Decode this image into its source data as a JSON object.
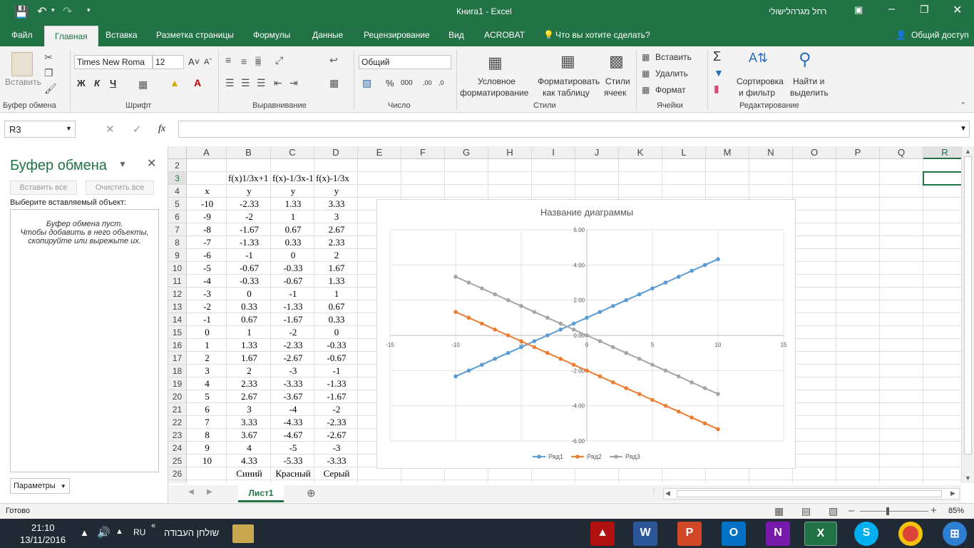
{
  "titlebar": {
    "title": "Книга1  -  Excel",
    "user": "רחל מגרהלישולי"
  },
  "tabs": [
    "Файл",
    "Главная",
    "Вставка",
    "Разметка страницы",
    "Формулы",
    "Данные",
    "Рецензирование",
    "Вид",
    "ACROBAT"
  ],
  "tell_me": "Что вы хотите сделать?",
  "share": "Общий доступ",
  "ribbon": {
    "paste": "Вставить",
    "clipboard_group": "Буфер обмена",
    "font_name": "Times New Roma",
    "font_size": "12",
    "bold": "Ж",
    "italic": "К",
    "underline": "Ч",
    "font_group": "Шрифт",
    "align_group": "Выравнивание",
    "number_format": "Общий",
    "number_group": "Число",
    "cond_format_1": "Условное",
    "cond_format_2": "форматирование",
    "format_table_1": "Форматировать",
    "format_table_2": "как таблицу",
    "cell_styles_1": "Стили",
    "cell_styles_2": "ячеек",
    "styles_group": "Стили",
    "insert": "Вставить",
    "delete": "Удалить",
    "format": "Формат",
    "cells_group": "Ячейки",
    "sort_1": "Сортировка",
    "sort_2": "и фильтр",
    "find_1": "Найти и",
    "find_2": "выделить",
    "edit_group": "Редактирование"
  },
  "namebox": "R3",
  "fx": "fx",
  "clipboard_pane": {
    "title": "Буфер обмена",
    "paste_all": "Вставить все",
    "clear_all": "Очистить все",
    "choose": "Выберите вставляемый объект:",
    "empty1": "Буфер обмена пуст.",
    "empty2": "Чтобы добавить в него объекты,",
    "empty3": "скопируйте или вырежьте их.",
    "options": "Параметры"
  },
  "columns": [
    "A",
    "B",
    "C",
    "D",
    "E",
    "F",
    "G",
    "H",
    "I",
    "J",
    "K",
    "L",
    "M",
    "N",
    "O",
    "P",
    "Q",
    "R"
  ],
  "rows": [
    {
      "n": "2",
      "c": [
        "",
        "",
        "",
        ""
      ]
    },
    {
      "n": "3",
      "c": [
        "",
        "f(x)1/3x+1",
        "f(x)-1/3x-1",
        "f(x)-1/3x"
      ]
    },
    {
      "n": "4",
      "c": [
        "x",
        "y",
        "y",
        "y"
      ]
    },
    {
      "n": "5",
      "c": [
        "-10",
        "-2.33",
        "1.33",
        "3.33"
      ]
    },
    {
      "n": "6",
      "c": [
        "-9",
        "-2",
        "1",
        "3"
      ]
    },
    {
      "n": "7",
      "c": [
        "-8",
        "-1.67",
        "0.67",
        "2.67"
      ]
    },
    {
      "n": "8",
      "c": [
        "-7",
        "-1.33",
        "0.33",
        "2.33"
      ]
    },
    {
      "n": "9",
      "c": [
        "-6",
        "-1",
        "0",
        "2"
      ]
    },
    {
      "n": "10",
      "c": [
        "-5",
        "-0.67",
        "-0.33",
        "1.67"
      ]
    },
    {
      "n": "11",
      "c": [
        "-4",
        "-0.33",
        "-0.67",
        "1.33"
      ]
    },
    {
      "n": "12",
      "c": [
        "-3",
        "0",
        "-1",
        "1"
      ]
    },
    {
      "n": "13",
      "c": [
        "-2",
        "0.33",
        "-1.33",
        "0.67"
      ]
    },
    {
      "n": "14",
      "c": [
        "-1",
        "0.67",
        "-1.67",
        "0.33"
      ]
    },
    {
      "n": "15",
      "c": [
        "0",
        "1",
        "-2",
        "0"
      ]
    },
    {
      "n": "16",
      "c": [
        "1",
        "1.33",
        "-2.33",
        "-0.33"
      ]
    },
    {
      "n": "17",
      "c": [
        "2",
        "1.67",
        "-2.67",
        "-0.67"
      ]
    },
    {
      "n": "18",
      "c": [
        "3",
        "2",
        "-3",
        "-1"
      ]
    },
    {
      "n": "19",
      "c": [
        "4",
        "2.33",
        "-3.33",
        "-1.33"
      ]
    },
    {
      "n": "20",
      "c": [
        "5",
        "2.67",
        "-3.67",
        "-1.67"
      ]
    },
    {
      "n": "21",
      "c": [
        "6",
        "3",
        "-4",
        "-2"
      ]
    },
    {
      "n": "22",
      "c": [
        "7",
        "3.33",
        "-4.33",
        "-2.33"
      ]
    },
    {
      "n": "23",
      "c": [
        "8",
        "3.67",
        "-4.67",
        "-2.67"
      ]
    },
    {
      "n": "24",
      "c": [
        "9",
        "4",
        "-5",
        "-3"
      ]
    },
    {
      "n": "25",
      "c": [
        "10",
        "4.33",
        "-5.33",
        "-3.33"
      ]
    },
    {
      "n": "26",
      "c": [
        "",
        "Синий",
        "Красный",
        "Серый"
      ]
    }
  ],
  "chart_data": {
    "type": "scatter",
    "title": "Название диаграммы",
    "xlim": [
      -15,
      15
    ],
    "ylim": [
      -6,
      6
    ],
    "xticks": [
      "-15",
      "-10",
      "-5",
      "0",
      "5",
      "10",
      "15"
    ],
    "yticks": [
      "6.00",
      "4.00",
      "2.00",
      "0.00",
      "-2.00",
      "-4.00",
      "-6.00"
    ],
    "x": [
      -10,
      -9,
      -8,
      -7,
      -6,
      -5,
      -4,
      -3,
      -2,
      -1,
      0,
      1,
      2,
      3,
      4,
      5,
      6,
      7,
      8,
      9,
      10
    ],
    "series": [
      {
        "name": "Ряд1",
        "color": "#5b9bd5",
        "values": [
          -2.33,
          -2,
          -1.67,
          -1.33,
          -1,
          -0.67,
          -0.33,
          0,
          0.33,
          0.67,
          1,
          1.33,
          1.67,
          2,
          2.33,
          2.67,
          3,
          3.33,
          3.67,
          4,
          4.33
        ]
      },
      {
        "name": "Ряд2",
        "color": "#ed7d31",
        "values": [
          1.33,
          1,
          0.67,
          0.33,
          0,
          -0.33,
          -0.67,
          -1,
          -1.33,
          -1.67,
          -2,
          -2.33,
          -2.67,
          -3,
          -3.33,
          -3.67,
          -4,
          -4.33,
          -4.67,
          -5,
          -5.33
        ]
      },
      {
        "name": "Ряд3",
        "color": "#a5a5a5",
        "values": [
          3.33,
          3,
          2.67,
          2.33,
          2,
          1.67,
          1.33,
          1,
          0.67,
          0.33,
          0,
          -0.33,
          -0.67,
          -1,
          -1.33,
          -1.67,
          -2,
          -2.33,
          -2.67,
          -3,
          -3.33
        ]
      }
    ],
    "legend": "bottom",
    "grid": true
  },
  "sheet_tab": "Лист1",
  "status": {
    "ready": "Готово",
    "zoom": "85%"
  },
  "taskbar": {
    "time": "21:10",
    "date": "13/11/2016",
    "lang": "RU",
    "desktop": "שולחן העבודה"
  },
  "colors": {
    "excel_green": "#217346"
  }
}
